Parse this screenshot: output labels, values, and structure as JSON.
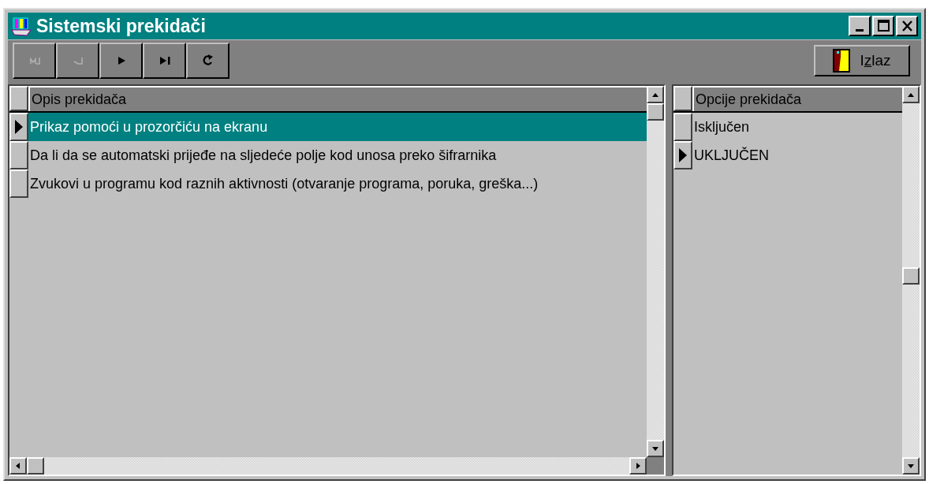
{
  "window": {
    "title": "Sistemski prekidači"
  },
  "toolbar": {
    "buttons": [
      {
        "kind": "first",
        "disabled": true
      },
      {
        "kind": "prev",
        "disabled": true
      },
      {
        "kind": "next",
        "disabled": false
      },
      {
        "kind": "last",
        "disabled": false
      },
      {
        "kind": "refresh",
        "disabled": false
      }
    ],
    "exit_button": {
      "label_before": "I",
      "access_key": "z",
      "label_after": "laz"
    }
  },
  "switches_grid": {
    "focused": true,
    "column": "Opis prekidača",
    "rows": [
      {
        "text": "Prikaz pomoći u prozorčiću na ekranu",
        "selected": true
      },
      {
        "text": "Da li da se automatski prijeđe na sljedeće polje kod unosa preko šifrarnika",
        "selected": false
      },
      {
        "text": "Zvukovi u programu kod raznih aktivnosti (otvaranje programa, poruka, greška...)",
        "selected": false
      }
    ]
  },
  "options_grid": {
    "focused": false,
    "column": "Opcije prekidača",
    "rows": [
      {
        "text": "Isključen",
        "selected": false
      },
      {
        "text": "UKLJUČEN",
        "selected": true
      }
    ]
  }
}
